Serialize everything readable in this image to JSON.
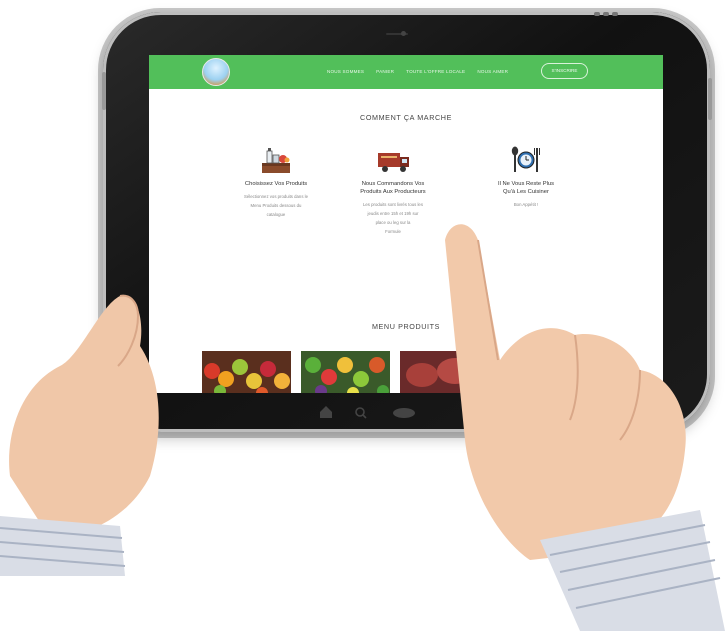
{
  "screen": {
    "nav_links": [
      "NOUS SOMMES",
      "PANIER",
      "TOUTE L'OFFRE LOCALE",
      "NOUS AIMER"
    ],
    "nav_button": "S'INSCRIRE",
    "how_it_works": {
      "title": "COMMENT ÇA MARCHE",
      "steps": [
        {
          "icon": "farm-products-icon",
          "title": "Choisissez Vos Produits",
          "text": [
            "Sélectionnez vos produits dans le",
            "Menu Produits dessous du",
            "catalogue"
          ]
        },
        {
          "icon": "delivery-truck-icon",
          "title_lines": [
            "Nous Commandons Vos",
            "Produits Aux Producteurs"
          ],
          "text": [
            "Les produits sont livrés tous les",
            "jeudis entre 15h et 19h sur",
            "place ou leg sur la",
            "Formule"
          ]
        },
        {
          "icon": "utensils-clock-icon",
          "title_lines": [
            "Il Ne Vous Reste Plus",
            "Qu'à Les Cuisiner"
          ],
          "text": [
            "Bon Appétit !"
          ]
        }
      ]
    },
    "products_menu": {
      "title": "MENU PRODUITS"
    },
    "colors": {
      "navbar": "#52bf5a",
      "text": "#333333"
    }
  }
}
